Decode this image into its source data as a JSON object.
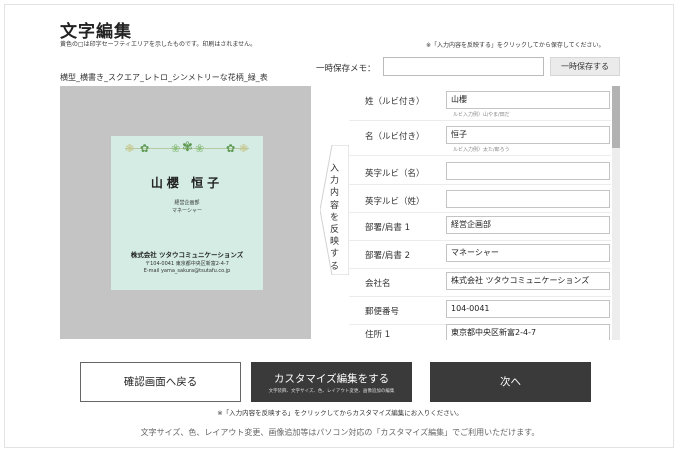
{
  "page": {
    "title": "文字編集",
    "subnote": "黄色の□は印字セーフティエリアを示したものです。印刷はされません。",
    "right_note": "※「入力内容を反映する」をクリックしてから保存してください。"
  },
  "memo": {
    "label": "一時保存メモ：",
    "value": "",
    "save_button": "一時保存する"
  },
  "design": {
    "label": "横型_横書き_スクエア_レトロ_シンメトリーな花柄_緑_表",
    "card": {
      "name": "山櫻 恒子",
      "department": "経営企画部",
      "title": "マネーシャー",
      "company": "株式会社 ツタウコミュニケーションズ",
      "address": "〒104-0041 東京都中央区新富2-4-7",
      "email": "E-mail yama_sakura@tsutafu.co.jp"
    }
  },
  "reflect_button": "入力内容を反映する",
  "form": {
    "rows": [
      {
        "label": "姓（ルビ付き）",
        "value": "山櫻",
        "hint": "ルビ入力例）山やま/田だ"
      },
      {
        "label": "名（ルビ付き）",
        "value": "恒子",
        "hint": "ルビ入力例）太た/郎ろう"
      },
      {
        "label": "英字ルビ（名）",
        "value": ""
      },
      {
        "label": "英字ルビ（姓）",
        "value": ""
      },
      {
        "label": "部署/肩書 1",
        "value": "経営企画部"
      },
      {
        "label": "部署/肩書 2",
        "value": "マネーシャー"
      },
      {
        "label": "会社名",
        "value": "株式会社 ツタウコミュニケーションズ"
      },
      {
        "label": "郵便番号",
        "value": "104-0041"
      },
      {
        "label": "住所 1",
        "value": "東京都中央区新富2-4-7"
      }
    ]
  },
  "actions": {
    "back": "確認画面へ戻る",
    "customize": "カスタマイズ編集をする",
    "customize_sub": "文字装飾、文字サイズ、色、レイアウト変更、画像追加の編集",
    "next": "次へ"
  },
  "footer": {
    "note1": "※「入力内容を反映する」をクリックしてからカスタマイズ編集にお入りください。",
    "note2": "文字サイズ、色、レイアウト変更、画像追加等はパソコン対応の「カスタマイズ編集」でご利用いただけます。"
  },
  "colors": {
    "card_background": "#d4ece4",
    "flower": "#5f9a52",
    "dark_button": "#3a3a3a",
    "preview_background": "#c4c4c4"
  },
  "icons": [
    "flower-ornament-icon",
    "arrow-left-tab-icon"
  ]
}
